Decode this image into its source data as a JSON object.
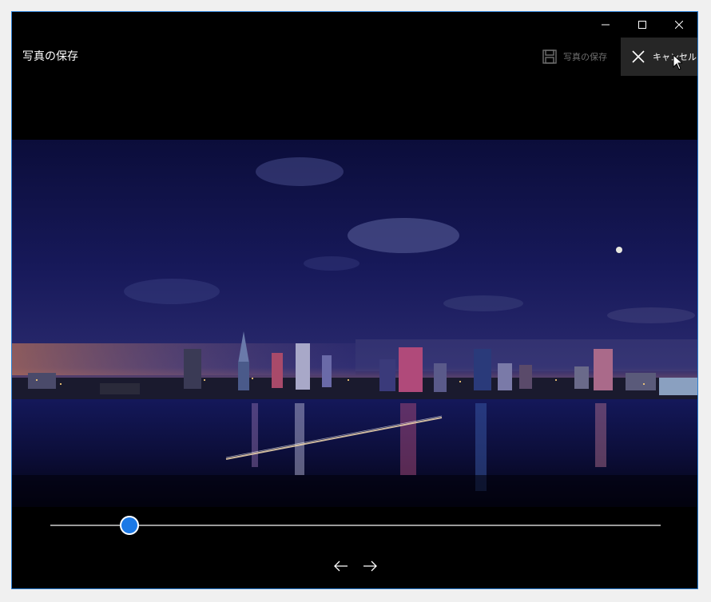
{
  "window": {
    "title": "写真の保存",
    "controls": {
      "minimize": "minimize",
      "maximize": "maximize",
      "close": "close"
    }
  },
  "commands": {
    "save_label": "写真の保存",
    "cancel_label": "キャンセル"
  },
  "photo": {
    "subject": "city skyline at night over a river"
  },
  "trim_slider": {
    "value": 0.13
  },
  "navigation": {
    "prev": "previous-arrow-icon",
    "next": "next-arrow-icon"
  },
  "colors": {
    "accent": "#1b79e6",
    "window_border": "#2b7fd4",
    "background": "#000000"
  }
}
